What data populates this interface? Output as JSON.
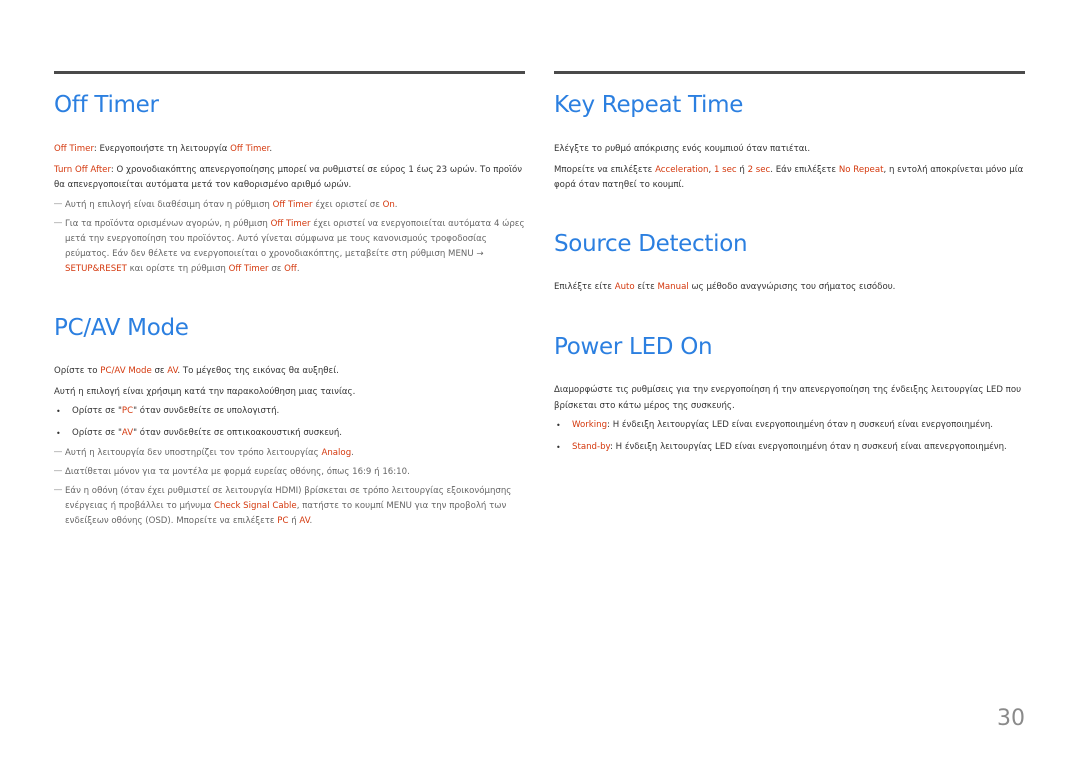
{
  "left": {
    "off_timer": {
      "title": "Off Timer",
      "p1": {
        "hl": "Off Timer",
        "t1": ": Ενεργοποιήστε τη λειτουργία ",
        "hl2": "Off Timer",
        "t2": "."
      },
      "p2": {
        "hl": "Turn Off After",
        "t1": ": Ο χρονοδιακόπτης απενεργοποίησης μπορεί να ρυθμιστεί σε εύρος 1 έως 23 ωρών. Το προϊόν θα απενεργοποιείται αυτόματα μετά τον καθορισμένο αριθμό ωρών."
      },
      "note1": {
        "t1": "Αυτή η επιλογή είναι διαθέσιμη όταν η ρύθμιση ",
        "hl": "Off Timer",
        "t2": " έχει οριστεί σε ",
        "hl2": "On",
        "t3": "."
      },
      "note2": {
        "t1": "Για τα προϊόντα ορισμένων αγορών, η ρύθμιση ",
        "hl": "Off Timer",
        "t2": " έχει οριστεί να ενεργοποιείται αυτόματα 4 ώρες μετά την ενεργοποίηση του προϊόντος. Αυτό γίνεται σύμφωνα με τους κανονισμούς τροφοδοσίας ρεύματος. Εάν δεν θέλετε να ενεργοποιείται ο χρονοδιακόπτης, μεταβείτε στη ρύθμιση MENU → ",
        "hl2": "SETUP&RESET",
        "t3": " και ορίστε τη ρύθμιση ",
        "hl3": "Off Timer",
        "t4": " σε ",
        "hl4": "Off",
        "t5": "."
      }
    },
    "pcav": {
      "title": "PC/AV Mode",
      "p1": {
        "t1": "Ορίστε το ",
        "hl": "PC/AV Mode",
        "t2": " σε ",
        "hl2": "AV",
        "t3": ". Το μέγεθος της εικόνας θα αυξηθεί."
      },
      "p2": "Αυτή η επιλογή είναι χρήσιμη κατά την παρακολούθηση μιας ταινίας.",
      "b1": {
        "t1": "Ορίστε σε \"",
        "hl": "PC",
        "t2": "\" όταν συνδεθείτε σε υπολογιστή."
      },
      "b2": {
        "t1": "Ορίστε σε \"",
        "hl": "AV",
        "t2": "\" όταν συνδεθείτε σε οπτικοακουστική συσκευή."
      },
      "note1": {
        "t1": "Αυτή η λειτουργία δεν υποστηρίζει τον τρόπο λειτουργίας ",
        "hl": "Analog",
        "t2": "."
      },
      "note2": "Διατίθεται μόνον για τα μοντέλα με φορμά ευρείας οθόνης, όπως 16:9 ή 16:10.",
      "note3": {
        "t1": "Εάν η οθόνη (όταν έχει ρυθμιστεί σε λειτουργία HDMI) βρίσκεται σε τρόπο λειτουργίας εξοικονόμησης ενέργειας ή προβάλλει το μήνυμα ",
        "hl": "Check Signal Cable",
        "t2": ", πατήστε το κουμπί MENU για την προβολή των ενδείξεων οθόνης (OSD). Μπορείτε να επιλέξετε ",
        "hl2": "PC",
        "t3": " ή ",
        "hl3": "AV",
        "t4": "."
      }
    }
  },
  "right": {
    "key_repeat": {
      "title": "Key Repeat Time",
      "p1": "Ελέγξτε το ρυθμό απόκρισης ενός κουμπιού όταν πατιέται.",
      "p2": {
        "t1": "Μπορείτε να επιλέξετε ",
        "hl": "Acceleration",
        "t2": ", ",
        "hl2": "1 sec",
        "t3": " ή ",
        "hl3": "2 sec",
        "t4": ". Εάν επιλέξετε ",
        "hl4": "No Repeat",
        "t5": ", η εντολή αποκρίνεται μόνο μία φορά όταν πατηθεί το κουμπί."
      }
    },
    "source": {
      "title": "Source Detection",
      "p1": {
        "t1": "Επιλέξτε είτε ",
        "hl": "Auto",
        "t2": " είτε ",
        "hl2": "Manual",
        "t3": " ως μέθοδο αναγνώρισης του σήματος εισόδου."
      }
    },
    "power_led": {
      "title": "Power LED On",
      "p1": "Διαμορφώστε τις ρυθμίσεις για την ενεργοποίηση ή την απενεργοποίηση της ένδειξης λειτουργίας LED που βρίσκεται στο κάτω μέρος της συσκευής.",
      "b1": {
        "hl": "Working",
        "t1": ": Η ένδειξη λειτουργίας LED είναι ενεργοποιημένη όταν η συσκευή είναι ενεργοποιημένη."
      },
      "b2": {
        "hl": "Stand-by",
        "t1": ": Η ένδειξη λειτουργίας LED είναι ενεργοποιημένη όταν η συσκευή είναι απενεργοποιημένη."
      }
    }
  },
  "icons": {
    "note_dash": "―",
    "bullet": "•"
  },
  "colors": {
    "heading": "#2b7fe0",
    "highlight": "#d4380d",
    "body": "#333333",
    "note": "#666666"
  },
  "page_number": "30"
}
